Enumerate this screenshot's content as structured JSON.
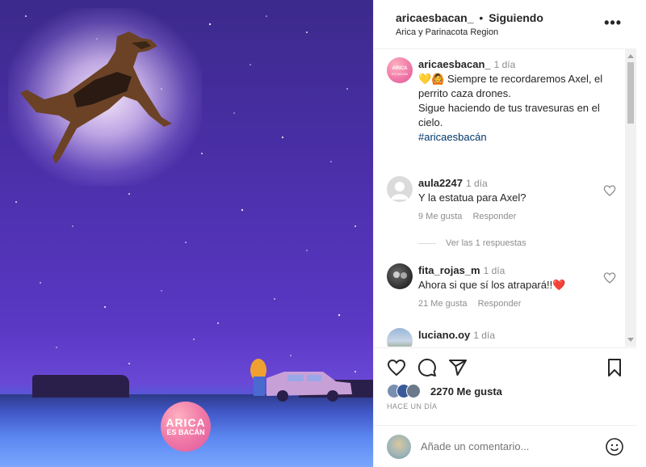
{
  "post": {
    "badge_line1": "ARICA",
    "badge_line2": "ES BACÁN"
  },
  "header": {
    "username": "aricaesbacan_",
    "separator": "•",
    "follow_status": "Siguiendo",
    "location": "Arica y Parinacota Region",
    "more_label": "•••"
  },
  "caption": {
    "username": "aricaesbacan_",
    "time": "1 día",
    "text_line1": "💛🙆 Siempre te recordaremos Axel, el perrito caza drones.",
    "text_line2": "Sigue haciendo de tus travesuras en el cielo.",
    "hashtag": "#aricaesbacán"
  },
  "comments": [
    {
      "username": "aula2247",
      "time": "1 día",
      "text": "Y la estatua para Axel?",
      "likes": "9 Me gusta",
      "reply_label": "Responder"
    },
    {
      "username": "fita_rojas_m",
      "time": "1 día",
      "text": "Ahora si que sí los atrapará!!❤️",
      "likes": "21 Me gusta",
      "reply_label": "Responder"
    },
    {
      "username": "luciano.oy",
      "time": "1 día"
    }
  ],
  "view_replies": "Ver las 1 respuestas",
  "actions": {
    "likes_count": "2270 Me gusta",
    "posted_ago": "HACE UN DÍA"
  },
  "add_comment": {
    "placeholder": "Añade un comentario..."
  },
  "colors": {
    "sky": "#4a2fa8",
    "heart_red": "#ed4956",
    "link": "#00376b"
  }
}
